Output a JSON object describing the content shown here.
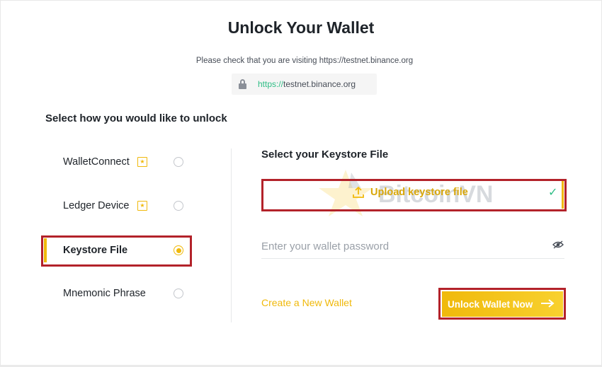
{
  "title": "Unlock Your Wallet",
  "notice": "Please check that you are visiting https://testnet.binance.org",
  "url_bar": {
    "icon": "lock-icon",
    "protocol": "https://",
    "domain": "testnet.binance.org"
  },
  "unlock_prompt": "Select how you would like to unlock",
  "options": [
    {
      "label": "WalletConnect",
      "badge_icon": "award-badge-icon",
      "selected": false
    },
    {
      "label": "Ledger Device",
      "badge_icon": "award-badge-icon",
      "selected": false
    },
    {
      "label": "Keystore File",
      "selected": true
    },
    {
      "label": "Mnemonic Phrase",
      "selected": false
    }
  ],
  "keystore": {
    "title": "Select your Keystore File",
    "upload_label": "Upload keystore file",
    "upload_icon": "upload-icon",
    "status_icon": "check-icon"
  },
  "password": {
    "placeholder": "Enter your wallet password",
    "value": "",
    "toggle_icon": "eye-icon"
  },
  "create_wallet_link": "Create a New Wallet",
  "unlock_button": {
    "label": "Unlock Wallet Now",
    "icon": "arrow-right-icon"
  },
  "watermark": "BitcoinVN",
  "colors": {
    "accent": "#f0b90b",
    "success": "#2ebd85",
    "highlight": "#b3222a",
    "text": "#1e2329"
  }
}
